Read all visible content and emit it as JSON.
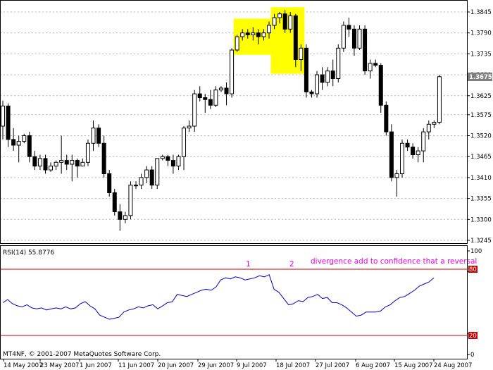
{
  "chart_data": [
    {
      "type": "candlestick",
      "y_ticks": [
        "1.3845",
        "1.3790",
        "1.3735",
        "1.3680",
        "1.3625",
        "1.3575",
        "1.3520",
        "1.3465",
        "1.3410",
        "1.3355",
        "1.3300",
        "1.3245"
      ],
      "ylim": [
        1.3245,
        1.3845
      ],
      "current_price": "1.3675",
      "date_labels": [
        "14 May 2007",
        "23 May 2007",
        "1 Jun 2007",
        "11 Jun 2007",
        "20 Jun 2007",
        "29 Jun 2007",
        "9 Jul 2007",
        "18 Jul 2007",
        "27 Jul 2007",
        "6 Aug 2007",
        "15 Aug 2007",
        "24 Aug 2007"
      ],
      "candles": [
        [
          1.3545,
          1.3612,
          1.351,
          1.3598
        ],
        [
          1.3598,
          1.3605,
          1.349,
          1.351
        ],
        [
          1.351,
          1.354,
          1.348,
          1.3495
        ],
        [
          1.3495,
          1.352,
          1.345,
          1.3505
        ],
        [
          1.3505,
          1.3525,
          1.35,
          1.352
        ],
        [
          1.352,
          1.353,
          1.345,
          1.3465
        ],
        [
          1.3465,
          1.348,
          1.343,
          1.344
        ],
        [
          1.344,
          1.347,
          1.343,
          1.346
        ],
        [
          1.346,
          1.347,
          1.342,
          1.343
        ],
        [
          1.343,
          1.345,
          1.3425,
          1.344
        ],
        [
          1.344,
          1.3455,
          1.343,
          1.345
        ],
        [
          1.345,
          1.352,
          1.342,
          1.3455
        ],
        [
          1.3455,
          1.347,
          1.343,
          1.3445
        ],
        [
          1.3445,
          1.347,
          1.34,
          1.3455
        ],
        [
          1.3455,
          1.346,
          1.341,
          1.344
        ],
        [
          1.344,
          1.346,
          1.344,
          1.345
        ],
        [
          1.345,
          1.351,
          1.344,
          1.35
        ],
        [
          1.35,
          1.356,
          1.348,
          1.354
        ],
        [
          1.354,
          1.355,
          1.349,
          1.35
        ],
        [
          1.35,
          1.352,
          1.341,
          1.342
        ],
        [
          1.342,
          1.343,
          1.336,
          1.337
        ],
        [
          1.337,
          1.338,
          1.331,
          1.332
        ],
        [
          1.332,
          1.334,
          1.327,
          1.33
        ],
        [
          1.33,
          1.332,
          1.329,
          1.331
        ],
        [
          1.331,
          1.34,
          1.33,
          1.339
        ],
        [
          1.339,
          1.34,
          1.338,
          1.339
        ],
        [
          1.339,
          1.342,
          1.338,
          1.341
        ],
        [
          1.341,
          1.344,
          1.3395,
          1.343
        ],
        [
          1.343,
          1.344,
          1.338,
          1.339
        ],
        [
          1.339,
          1.346,
          1.338,
          1.346
        ],
        [
          1.346,
          1.347,
          1.3455,
          1.3465
        ],
        [
          1.3465,
          1.347,
          1.344,
          1.3455
        ],
        [
          1.3455,
          1.347,
          1.342,
          1.344
        ],
        [
          1.344,
          1.347,
          1.343,
          1.3465
        ],
        [
          1.3465,
          1.3545,
          1.343,
          1.354
        ],
        [
          1.354,
          1.356,
          1.353,
          1.3545
        ],
        [
          1.3545,
          1.364,
          1.353,
          1.363
        ],
        [
          1.363,
          1.365,
          1.361,
          1.362
        ],
        [
          1.362,
          1.363,
          1.358,
          1.3615
        ],
        [
          1.3615,
          1.364,
          1.359,
          1.36
        ],
        [
          1.36,
          1.365,
          1.3595,
          1.364
        ],
        [
          1.364,
          1.365,
          1.3635,
          1.3645
        ],
        [
          1.3645,
          1.366,
          1.36,
          1.363
        ],
        [
          1.363,
          1.375,
          1.362,
          1.3745
        ],
        [
          1.3745,
          1.3785,
          1.374,
          1.378
        ],
        [
          1.378,
          1.38,
          1.377,
          1.379
        ],
        [
          1.379,
          1.38,
          1.3775,
          1.3785
        ],
        [
          1.3785,
          1.3805,
          1.377,
          1.379
        ],
        [
          1.379,
          1.38,
          1.376,
          1.378
        ],
        [
          1.378,
          1.38,
          1.377,
          1.379
        ],
        [
          1.379,
          1.382,
          1.3775,
          1.381
        ],
        [
          1.381,
          1.384,
          1.38,
          1.383
        ],
        [
          1.383,
          1.3845,
          1.3815,
          1.384
        ],
        [
          1.384,
          1.385,
          1.379,
          1.38
        ],
        [
          1.38,
          1.3845,
          1.379,
          1.3835
        ],
        [
          1.3835,
          1.384,
          1.37,
          1.372
        ],
        [
          1.372,
          1.376,
          1.369,
          1.375
        ],
        [
          1.375,
          1.376,
          1.362,
          1.3635
        ],
        [
          1.3635,
          1.364,
          1.362,
          1.363
        ],
        [
          1.363,
          1.369,
          1.362,
          1.368
        ],
        [
          1.368,
          1.37,
          1.364,
          1.366
        ],
        [
          1.366,
          1.37,
          1.365,
          1.369
        ],
        [
          1.369,
          1.372,
          1.365,
          1.367
        ],
        [
          1.367,
          1.376,
          1.366,
          1.375
        ],
        [
          1.375,
          1.382,
          1.374,
          1.381
        ],
        [
          1.381,
          1.383,
          1.378,
          1.38
        ],
        [
          1.38,
          1.381,
          1.373,
          1.375
        ],
        [
          1.375,
          1.381,
          1.3745,
          1.38
        ],
        [
          1.38,
          1.381,
          1.368,
          1.369
        ],
        [
          1.369,
          1.372,
          1.367,
          1.371
        ],
        [
          1.371,
          1.372,
          1.37,
          1.3705
        ],
        [
          1.3705,
          1.371,
          1.358,
          1.36
        ],
        [
          1.36,
          1.361,
          1.352,
          1.353
        ],
        [
          1.353,
          1.355,
          1.34,
          1.341
        ],
        [
          1.341,
          1.343,
          1.336,
          1.342
        ],
        [
          1.342,
          1.351,
          1.341,
          1.35
        ],
        [
          1.35,
          1.351,
          1.348,
          1.349
        ],
        [
          1.349,
          1.35,
          1.346,
          1.347
        ],
        [
          1.347,
          1.349,
          1.345,
          1.348
        ],
        [
          1.348,
          1.354,
          1.345,
          1.353
        ],
        [
          1.353,
          1.356,
          1.351,
          1.355
        ],
        [
          1.355,
          1.356,
          1.354,
          1.3555
        ],
        [
          1.3555,
          1.368,
          1.355,
          1.3675
        ]
      ],
      "highlight_boxes": [
        [
          44,
          50
        ],
        [
          51,
          56
        ]
      ]
    },
    {
      "type": "line",
      "title": "RSI(14) 55.8776",
      "ylim": [
        0,
        100
      ],
      "y_ticks": [
        "100",
        "80",
        "20",
        "0"
      ],
      "levels": [
        80,
        20
      ],
      "level_color": "#cc0000",
      "line_color": "#0000cc",
      "values": [
        50,
        53,
        49,
        47,
        46,
        48,
        45,
        44,
        45,
        43,
        44,
        45,
        44,
        46,
        44,
        45,
        49,
        51,
        47,
        44,
        38,
        36,
        34,
        35,
        36,
        41,
        43,
        44,
        46,
        45,
        47,
        48,
        44,
        47,
        50,
        51,
        58,
        57,
        56,
        58,
        60,
        62,
        63,
        62,
        65,
        72,
        74,
        73,
        75,
        74,
        72,
        73,
        74,
        76,
        75,
        77,
        63,
        60,
        54,
        48,
        49,
        52,
        51,
        55,
        56,
        58,
        54,
        55,
        50,
        50,
        48,
        45,
        41,
        37,
        38,
        41,
        41,
        41,
        42,
        46,
        48,
        52,
        55,
        56,
        59,
        62,
        66,
        68,
        70,
        74
      ]
    }
  ],
  "status": {
    "rsi_label": "RSI(14) 55.8776",
    "annotation": "divergence add to confidence that a reversal",
    "marker_1": "1",
    "marker_2": "2",
    "copyright": "MT4NF, © 2001-2007 MetaQuotes Software Corp."
  },
  "colors": {
    "candle_up": "#ffffff",
    "candle_down": "#000000",
    "highlight": "#ffff00",
    "annotation": "#ee00ee",
    "price_tag_bg": "#7f7f7f"
  }
}
